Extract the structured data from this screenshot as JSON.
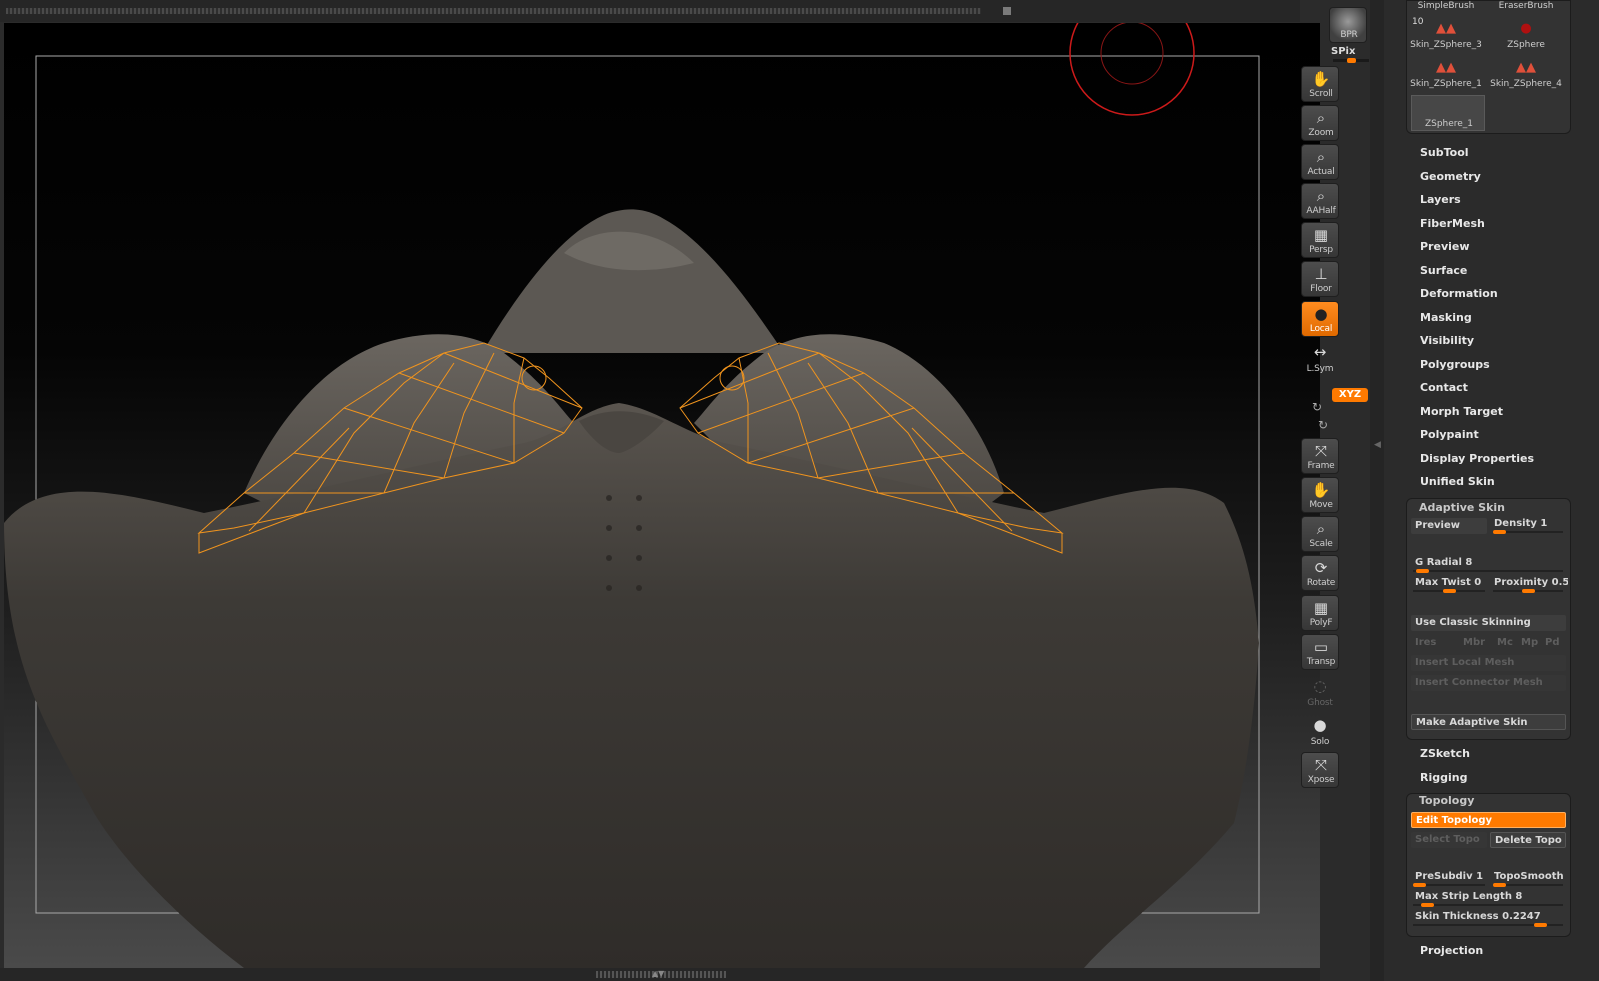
{
  "toolbar": {
    "bpr": "BPR",
    "spix": "SPix",
    "scroll": "Scroll",
    "zoom": "Zoom",
    "actual": "Actual",
    "aahalf": "AAHalf",
    "persp": "Persp",
    "floor": "Floor",
    "local": "Local",
    "lsym": "L.Sym",
    "xyz": "XYZ",
    "frame": "Frame",
    "move": "Move",
    "scale": "Scale",
    "rotate": "Rotate",
    "polyf": "PolyF",
    "transp": "Transp",
    "ghost": "Ghost",
    "solo": "Solo",
    "xpose": "Xpose"
  },
  "brushes": {
    "simple": "SimpleBrush",
    "eraser": "EraserBrush",
    "count": "10",
    "skin3": "Skin_ZSphere_3",
    "zsphere": "ZSphere",
    "skin1": "Skin_ZSphere_1",
    "skin4": "Skin_ZSphere_4",
    "zsphere1": "ZSphere_1"
  },
  "menu": {
    "subtool": "SubTool",
    "geometry": "Geometry",
    "layers": "Layers",
    "fibermesh": "FiberMesh",
    "preview": "Preview",
    "surface": "Surface",
    "deformation": "Deformation",
    "masking": "Masking",
    "visibility": "Visibility",
    "polygroups": "Polygroups",
    "contact": "Contact",
    "morph_target": "Morph Target",
    "polypaint": "Polypaint",
    "display_properties": "Display Properties",
    "unified_skin": "Unified Skin",
    "zsketch": "ZSketch",
    "rigging": "Rigging",
    "projection": "Projection"
  },
  "adaptive_skin": {
    "title": "Adaptive Skin",
    "preview": "Preview",
    "density": "Density 1",
    "g_radial": "G Radial 8",
    "max_twist": "Max Twist 0",
    "proximity": "Proximity 0.5",
    "use_classic": "Use Classic Skinning",
    "ires": "Ires",
    "mbr": "Mbr",
    "mc": "Mc",
    "mp": "Mp",
    "pd": "Pd",
    "insert_local": "Insert Local Mesh",
    "insert_connector": "Insert Connector Mesh",
    "make_adaptive": "Make Adaptive Skin"
  },
  "topology": {
    "title": "Topology",
    "edit": "Edit Topology",
    "select": "Select Topo",
    "delete": "Delete Topo",
    "presubdiv": "PreSubdiv 1",
    "toposmooth": "TopoSmooth",
    "max_strip": "Max Strip Length 8",
    "skin_thickness": "Skin Thickness 0.2247"
  },
  "colors": {
    "accent": "#ff7a00",
    "wire": "#f0941e",
    "cursor": "#cc1a1a"
  }
}
